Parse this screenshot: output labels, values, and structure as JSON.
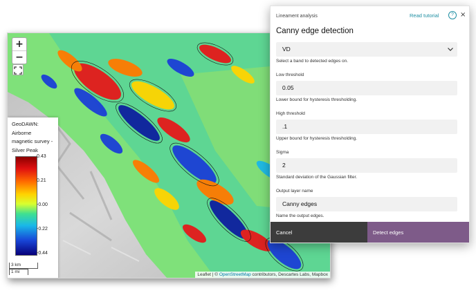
{
  "map": {
    "zoom_in_label": "+",
    "zoom_out_label": "−",
    "legend": {
      "title_lines": [
        "GeoDAWN: Airborne",
        "magnetic survey -",
        "Silver Peak"
      ],
      "ticks": [
        "0.43",
        "0.21",
        "-0.00",
        "-0.22",
        "-0.44"
      ]
    },
    "scale": {
      "metric": "3 km",
      "imperial": "1 mi"
    },
    "attribution": {
      "leaflet": "Leaflet",
      "sep1": " | © ",
      "osm": "OpenStreetMap",
      "rest": " contributors, Descartes Labs, Mapbox"
    }
  },
  "dialog": {
    "kicker": "Lineament analysis",
    "title": "Canny edge detection",
    "tutorial_link": "Read tutorial",
    "help_glyph": "?",
    "close_glyph": "×",
    "band": {
      "value": "VD",
      "hint": "Select a band to detected edges on."
    },
    "low_threshold": {
      "label": "Low threshold",
      "value": "0.05",
      "hint": "Lower bound for hysteresis thresholding."
    },
    "high_threshold": {
      "label": "High threshold",
      "value": ".1",
      "hint": "Upper bound for hysteresis thresholding."
    },
    "sigma": {
      "label": "Sigma",
      "value": "2",
      "hint": "Standard deviation of the Gaussian filter."
    },
    "output_name": {
      "label": "Output layer name",
      "value": "Canny edges",
      "hint": "Name the output edges."
    },
    "cancel_label": "Cancel",
    "detect_label": "Detect edges"
  },
  "colors": {
    "accent": "#7e5b89",
    "cancel_bg": "#3c3c3c",
    "link": "#1f8fa3"
  },
  "icons": [
    "zoom-in-icon",
    "zoom-out-icon",
    "fullscreen-icon",
    "help-icon",
    "close-icon",
    "chevron-down-icon"
  ]
}
